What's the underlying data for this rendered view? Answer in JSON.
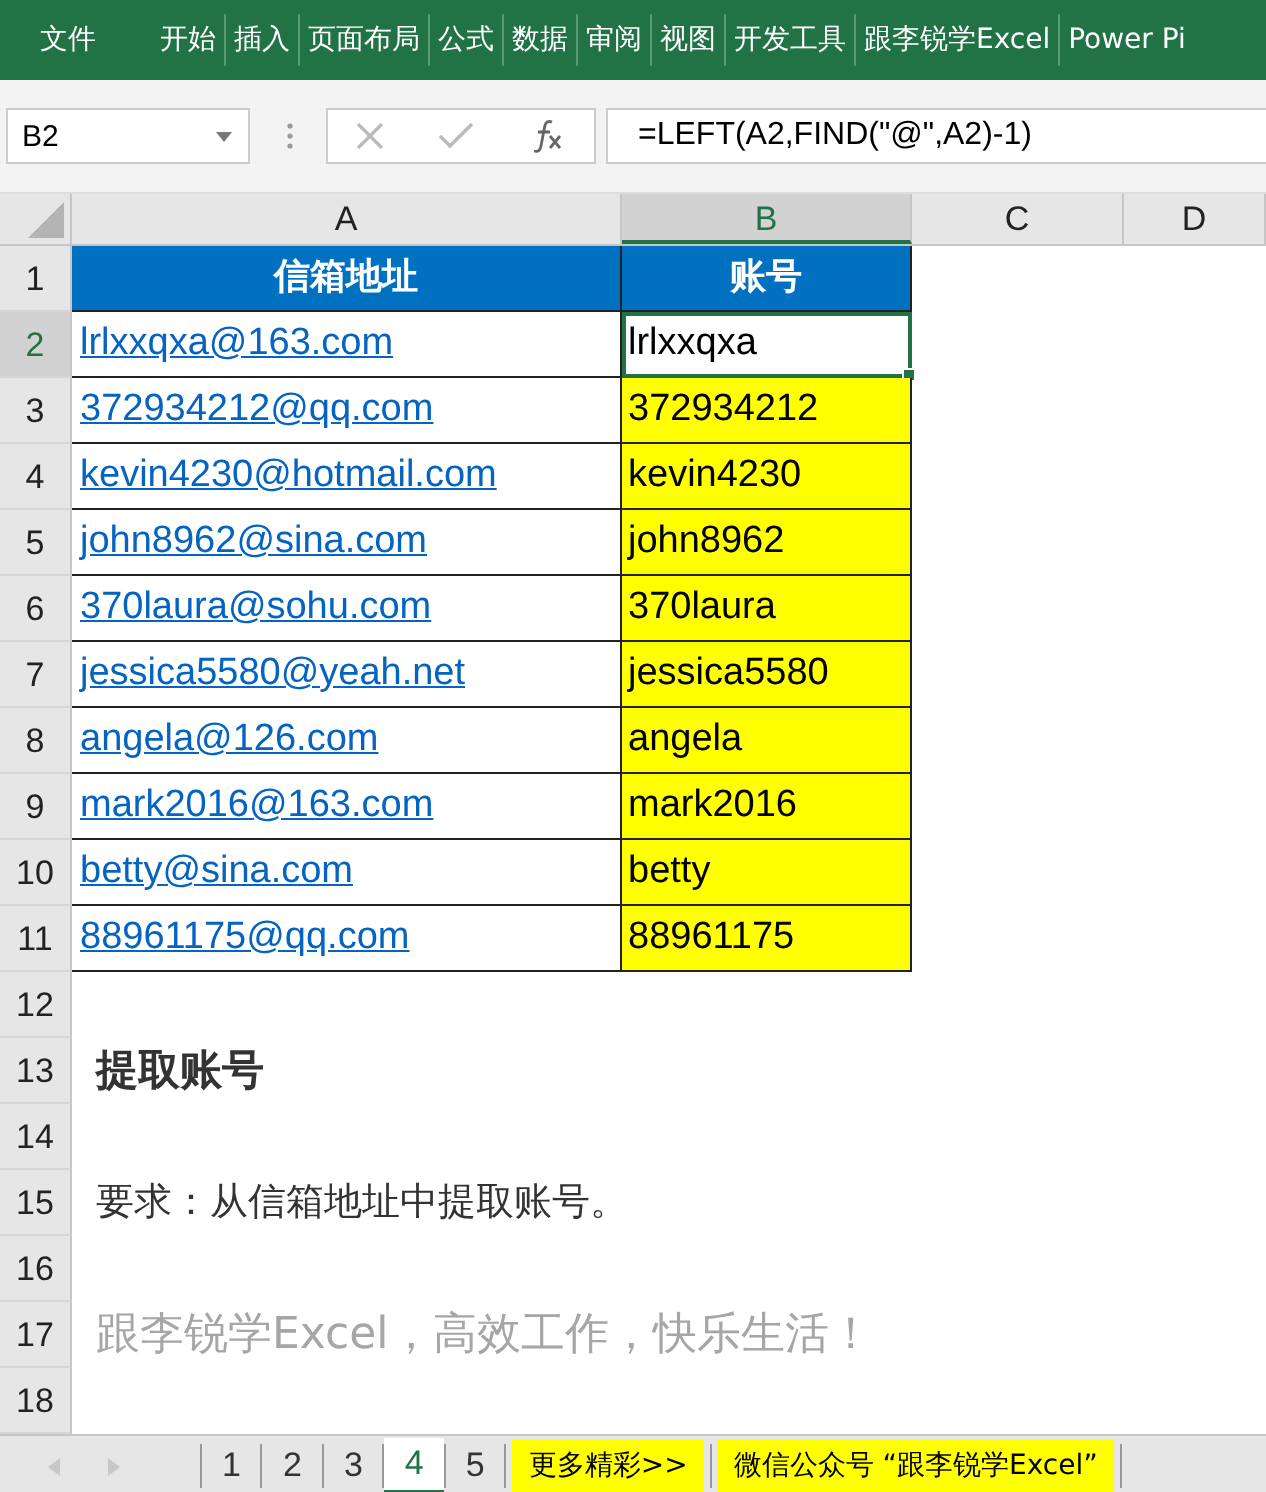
{
  "ribbon_tabs": [
    {
      "label": "文件",
      "selected": false
    },
    {
      "label": "开始",
      "selected": false
    },
    {
      "label": "插入",
      "selected": false
    },
    {
      "label": "页面布局",
      "selected": false
    },
    {
      "label": "公式",
      "selected": false
    },
    {
      "label": "数据",
      "selected": false
    },
    {
      "label": "审阅",
      "selected": false
    },
    {
      "label": "视图",
      "selected": false
    },
    {
      "label": "开发工具",
      "selected": false
    },
    {
      "label": "跟李锐学Excel",
      "selected": false
    },
    {
      "label": "Power Pi",
      "selected": false
    }
  ],
  "name_box": "B2",
  "formula": "=LEFT(A2,FIND(\"@\",A2)-1)",
  "columns": [
    {
      "label": "A",
      "selected": false
    },
    {
      "label": "B",
      "selected": true
    },
    {
      "label": "C",
      "selected": false
    },
    {
      "label": "D",
      "selected": false
    }
  ],
  "table": {
    "headers": [
      "信箱地址",
      "账号"
    ],
    "rows": [
      {
        "email": "lrlxxqxa@163.com",
        "account": "lrlxxqxa",
        "selected": true
      },
      {
        "email": "372934212@qq.com",
        "account": "372934212",
        "selected": false
      },
      {
        "email": "kevin4230@hotmail.com",
        "account": "kevin4230",
        "selected": false
      },
      {
        "email": "john8962@sina.com",
        "account": "john8962",
        "selected": false
      },
      {
        "email": "370laura@sohu.com",
        "account": "370laura",
        "selected": false
      },
      {
        "email": "jessica5580@yeah.net",
        "account": "jessica5580",
        "selected": false
      },
      {
        "email": "angela@126.com",
        "account": "angela",
        "selected": false
      },
      {
        "email": "mark2016@163.com",
        "account": "mark2016",
        "selected": false
      },
      {
        "email": "betty@sina.com",
        "account": "betty",
        "selected": false
      },
      {
        "email": "88961175@qq.com",
        "account": "88961175",
        "selected": false
      }
    ]
  },
  "row_numbers": [
    "1",
    "2",
    "3",
    "4",
    "5",
    "6",
    "7",
    "8",
    "9",
    "10",
    "11",
    "12",
    "13",
    "14",
    "15",
    "16",
    "17",
    "18"
  ],
  "notes": [
    {
      "kind": "title",
      "text": "提取账号"
    },
    {
      "kind": "body",
      "text": "要求：从信箱地址中提取账号。"
    },
    {
      "kind": "slogan",
      "text": "跟李锐学Excel，高效工作，快乐生活！"
    }
  ],
  "sheet_tabs": [
    {
      "label": "1",
      "kind": "sheet",
      "selected": false
    },
    {
      "label": "2",
      "kind": "sheet",
      "selected": false
    },
    {
      "label": "3",
      "kind": "sheet",
      "selected": false
    },
    {
      "label": "4",
      "kind": "sheet",
      "selected": true
    },
    {
      "label": "5",
      "kind": "sheet",
      "selected": false
    },
    {
      "label": "更多精彩>>",
      "kind": "promo",
      "selected": false
    },
    {
      "label": "微信公众号 “跟李锐学Excel”",
      "kind": "promo",
      "selected": false
    }
  ]
}
